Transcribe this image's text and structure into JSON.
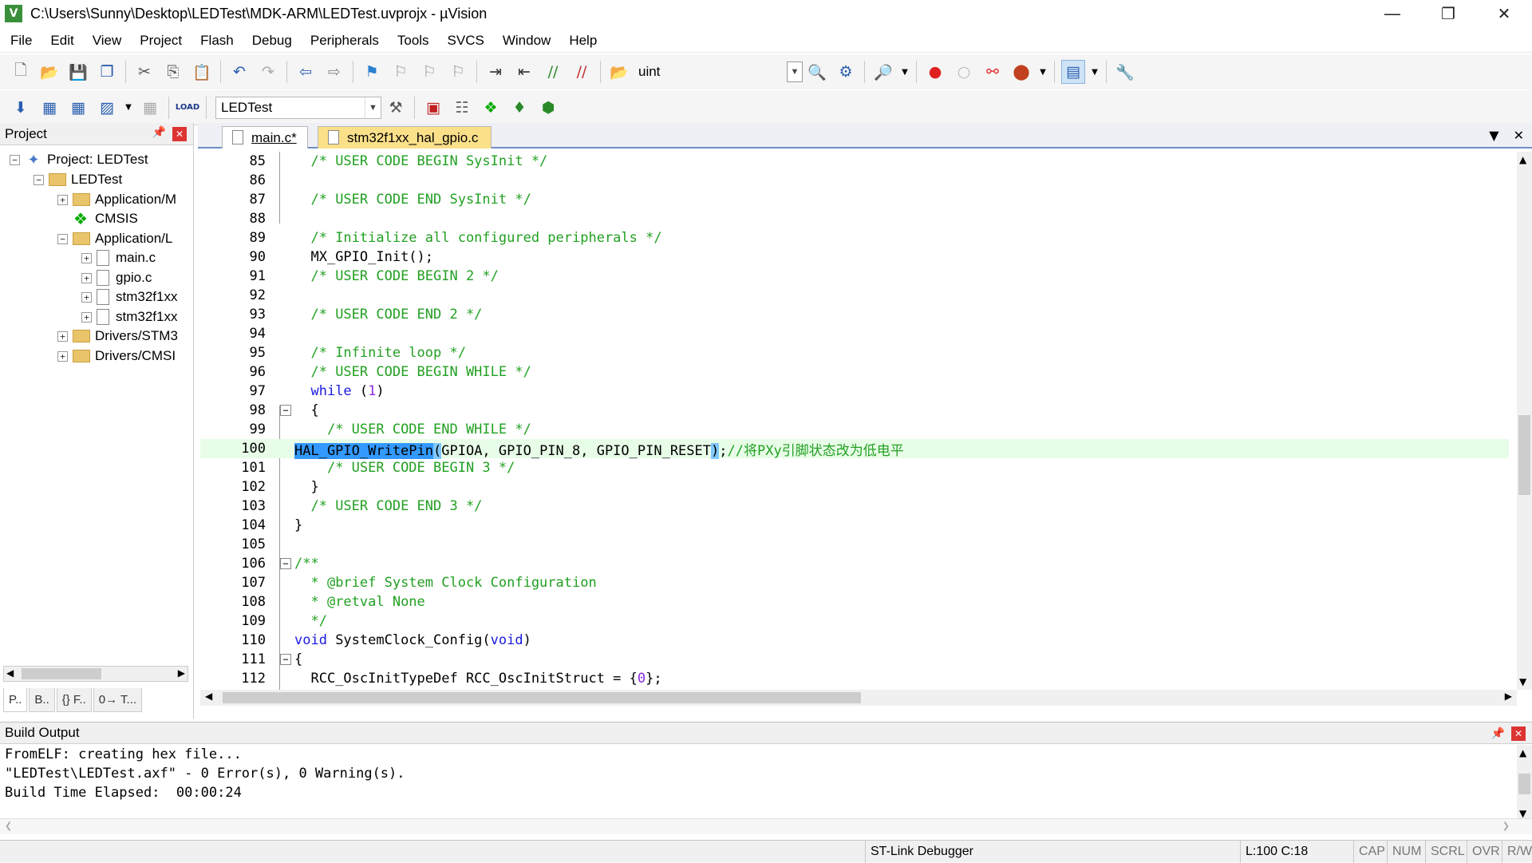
{
  "window": {
    "title": "C:\\Users\\Sunny\\Desktop\\LEDTest\\MDK-ARM\\LEDTest.uvprojx - µVision",
    "app_icon": "V",
    "minimize_icon": "minimize-icon",
    "restore_icon": "restore-icon",
    "close_icon": "close-icon"
  },
  "menu": [
    "File",
    "Edit",
    "View",
    "Project",
    "Flash",
    "Debug",
    "Peripherals",
    "Tools",
    "SVCS",
    "Window",
    "Help"
  ],
  "toolbar1": {
    "find_value": "uint"
  },
  "toolbar2": {
    "target_value": "LEDTest"
  },
  "project_panel": {
    "title": "Project",
    "tree": [
      {
        "label": "Project: LEDTest",
        "expander": "−",
        "icon": "project-icon"
      },
      {
        "label": "LEDTest",
        "expander": "−",
        "icon": "folder-icon"
      },
      {
        "label": "Application/M",
        "expander": "+",
        "icon": "folder-icon"
      },
      {
        "label": "CMSIS",
        "expander": "",
        "icon": "cmsis-icon"
      },
      {
        "label": "Application/L",
        "expander": "−",
        "icon": "folder-icon"
      },
      {
        "label": "main.c",
        "expander": "+",
        "icon": "file-icon"
      },
      {
        "label": "gpio.c",
        "expander": "+",
        "icon": "file-icon"
      },
      {
        "label": "stm32f1xx",
        "expander": "+",
        "icon": "file-icon"
      },
      {
        "label": "stm32f1xx",
        "expander": "+",
        "icon": "file-icon"
      },
      {
        "label": "Drivers/STM3",
        "expander": "+",
        "icon": "folder-icon"
      },
      {
        "label": "Drivers/CMSI",
        "expander": "+",
        "icon": "folder-icon"
      }
    ],
    "tabs": [
      "P..",
      "B..",
      "{} F..",
      "0→ T..."
    ]
  },
  "editor": {
    "tabs": [
      {
        "label": "main.c*",
        "active": true
      },
      {
        "label": "stm32f1xx_hal_gpio.c",
        "active": false
      }
    ],
    "current_line": "100",
    "lines": [
      {
        "n": "85",
        "indent": "  ",
        "parts": [
          {
            "t": "/* USER CODE BEGIN SysInit */",
            "c": "cm"
          }
        ]
      },
      {
        "n": "86",
        "indent": "",
        "parts": []
      },
      {
        "n": "87",
        "indent": "  ",
        "parts": [
          {
            "t": "/* USER CODE END SysInit */",
            "c": "cm"
          }
        ]
      },
      {
        "n": "88",
        "indent": "",
        "parts": []
      },
      {
        "n": "89",
        "indent": "  ",
        "parts": [
          {
            "t": "/* Initialize all configured peripherals */",
            "c": "cm"
          }
        ]
      },
      {
        "n": "90",
        "indent": "  ",
        "parts": [
          {
            "t": "MX_GPIO_Init();",
            "c": ""
          }
        ]
      },
      {
        "n": "91",
        "indent": "  ",
        "parts": [
          {
            "t": "/* USER CODE BEGIN 2 */",
            "c": "cm"
          }
        ]
      },
      {
        "n": "92",
        "indent": "",
        "parts": []
      },
      {
        "n": "93",
        "indent": "  ",
        "parts": [
          {
            "t": "/* USER CODE END 2 */",
            "c": "cm"
          }
        ]
      },
      {
        "n": "94",
        "indent": "",
        "parts": []
      },
      {
        "n": "95",
        "indent": "  ",
        "parts": [
          {
            "t": "/* Infinite loop */",
            "c": "cm"
          }
        ]
      },
      {
        "n": "96",
        "indent": "  ",
        "parts": [
          {
            "t": "/* USER CODE BEGIN WHILE */",
            "c": "cm"
          }
        ]
      },
      {
        "n": "97",
        "indent": "  ",
        "parts": [
          {
            "t": "while",
            "c": "kw"
          },
          {
            "t": " (",
            "c": ""
          },
          {
            "t": "1",
            "c": "num"
          },
          {
            "t": ")",
            "c": ""
          }
        ]
      },
      {
        "n": "98",
        "indent": "  ",
        "fold": "−",
        "parts": [
          {
            "t": "{",
            "c": ""
          }
        ]
      },
      {
        "n": "99",
        "indent": "    ",
        "parts": [
          {
            "t": "/* USER CODE END WHILE */",
            "c": "cm"
          }
        ]
      },
      {
        "n": "100",
        "indent": "",
        "cur": true,
        "parts": [
          {
            "t": "HAL_GPIO_WritePin",
            "c": "sel"
          },
          {
            "t": "(",
            "c": "hl"
          },
          {
            "t": "GPIOA, GPIO_PIN_8, GPIO_PIN_RESET",
            "c": ""
          },
          {
            "t": ")",
            "c": "hl"
          },
          {
            "t": ";",
            "c": ""
          },
          {
            "t": "//将PXy引脚状态改为低电平",
            "c": "cm"
          }
        ]
      },
      {
        "n": "101",
        "indent": "    ",
        "parts": [
          {
            "t": "/* USER CODE BEGIN 3 */",
            "c": "cm"
          }
        ]
      },
      {
        "n": "102",
        "indent": "  ",
        "parts": [
          {
            "t": "}",
            "c": ""
          }
        ]
      },
      {
        "n": "103",
        "indent": "  ",
        "parts": [
          {
            "t": "/* USER CODE END 3 */",
            "c": "cm"
          }
        ]
      },
      {
        "n": "104",
        "indent": "",
        "parts": [
          {
            "t": "}",
            "c": ""
          }
        ]
      },
      {
        "n": "105",
        "indent": "",
        "parts": []
      },
      {
        "n": "106",
        "indent": "",
        "fold": "−",
        "parts": [
          {
            "t": "/**",
            "c": "cm"
          }
        ]
      },
      {
        "n": "107",
        "indent": "  ",
        "parts": [
          {
            "t": "* @brief System Clock Configuration",
            "c": "cm"
          }
        ]
      },
      {
        "n": "108",
        "indent": "  ",
        "parts": [
          {
            "t": "* @retval None",
            "c": "cm"
          }
        ]
      },
      {
        "n": "109",
        "indent": "  ",
        "parts": [
          {
            "t": "*/",
            "c": "cm"
          }
        ]
      },
      {
        "n": "110",
        "indent": "",
        "parts": [
          {
            "t": "void",
            "c": "kw"
          },
          {
            "t": " SystemClock_Config(",
            "c": ""
          },
          {
            "t": "void",
            "c": "kw"
          },
          {
            "t": ")",
            "c": ""
          }
        ]
      },
      {
        "n": "111",
        "indent": "",
        "fold": "−",
        "parts": [
          {
            "t": "{",
            "c": ""
          }
        ]
      },
      {
        "n": "112",
        "indent": "  ",
        "parts": [
          {
            "t": "RCC_OscInitTypeDef RCC_OscInitStruct = {",
            "c": ""
          },
          {
            "t": "0",
            "c": "num"
          },
          {
            "t": "};",
            "c": ""
          }
        ]
      }
    ]
  },
  "build_output": {
    "title": "Build Output",
    "lines": [
      "FromELF: creating hex file...",
      "\"LEDTest\\LEDTest.axf\" - 0 Error(s), 0 Warning(s).",
      "Build Time Elapsed:  00:00:24"
    ]
  },
  "status": {
    "debugger": "ST-Link Debugger",
    "position": "L:100 C:18",
    "cap": "CAP",
    "num": "NUM",
    "scrl": "SCRL",
    "ovr": "OVR",
    "rw": "R/W"
  },
  "colors": {
    "comment": "#22a022",
    "keyword": "#1a1ae0",
    "number": "#8a2be2",
    "selection": "#3399ff",
    "current_line": "#e8fde8",
    "inactive_tab": "#fbe08a"
  }
}
